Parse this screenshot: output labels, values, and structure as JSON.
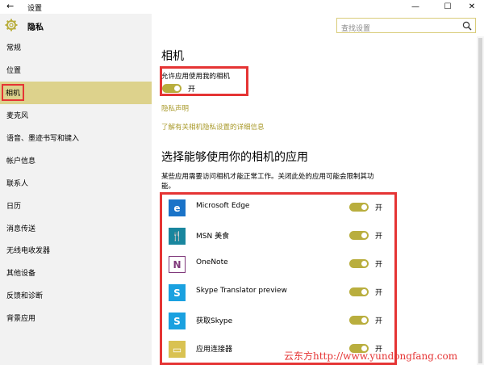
{
  "window": {
    "title": "设置",
    "controls": [
      "—",
      "☐",
      "✕"
    ]
  },
  "header": {
    "page_title": "隐私",
    "search_placeholder": "查找设置"
  },
  "sidebar": {
    "items": [
      {
        "label": "常规"
      },
      {
        "label": "位置"
      },
      {
        "label": "相机",
        "active": true
      },
      {
        "label": "麦克风"
      },
      {
        "label": "语音、墨迹书写和键入"
      },
      {
        "label": "帐户信息"
      },
      {
        "label": "联系人"
      },
      {
        "label": "日历"
      },
      {
        "label": "消息传送"
      },
      {
        "label": "无线电收发器"
      },
      {
        "label": "其他设备"
      },
      {
        "label": "反馈和诊断"
      },
      {
        "label": "背景应用"
      }
    ]
  },
  "main": {
    "title": "相机",
    "permission_label": "允许应用使用我的相机",
    "permission_state": "开",
    "privacy_link": "隐私声明",
    "info_link": "了解有关相机隐私设置的详细信息",
    "apps_title": "选择能够使用你的相机的应用",
    "apps_desc": "某些应用需要访问相机才能正常工作。关闭此处的应用可能会限制其功能。",
    "apps": [
      {
        "name": "Microsoft Edge",
        "state": "开",
        "icon": "edge-icon",
        "icon_color": "#1a73c8",
        "glyph": "e"
      },
      {
        "name": "MSN 美食",
        "state": "开",
        "icon": "msn-food-icon",
        "icon_color": "#19869e",
        "glyph": "🍴"
      },
      {
        "name": "OneNote",
        "state": "开",
        "icon": "onenote-icon",
        "icon_color": "#ffffff",
        "glyph": "N"
      },
      {
        "name": "Skype Translator preview",
        "state": "开",
        "icon": "skype-translator-icon",
        "icon_color": "#1aa1e0",
        "glyph": "S"
      },
      {
        "name": "获取Skype",
        "state": "开",
        "icon": "skype-icon",
        "icon_color": "#1aa1e0",
        "glyph": "S"
      },
      {
        "name": "应用连接器",
        "state": "开",
        "icon": "app-connector-icon",
        "icon_color": "#d9c252",
        "glyph": "▭"
      }
    ]
  },
  "watermark": "云东方http://www.yundongfang.com",
  "colors": {
    "accent": "#b9ae3e",
    "active_nav": "#ddd28c",
    "highlight_border": "#e53434",
    "link": "#a99a2b"
  }
}
